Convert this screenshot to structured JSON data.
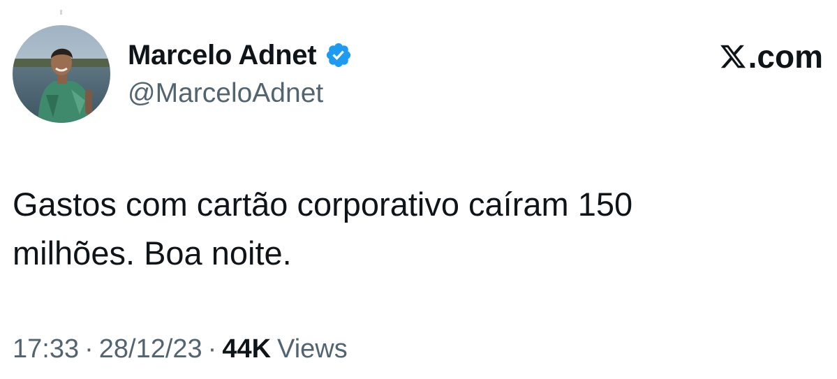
{
  "author": {
    "display_name": "Marcelo Adnet",
    "handle": "@MarceloAdnet",
    "verified": true,
    "verified_color": "#1d9bf0"
  },
  "watermark": {
    "text": ".com",
    "logo": "x-logo-icon"
  },
  "tweet": {
    "text": "Gastos com cartão corporativo caíram 150\nmilhões. Boa noite."
  },
  "meta": {
    "time": "17:33",
    "separator": "·",
    "date": "28/12/23",
    "views_count": "44K",
    "views_label": "Views"
  },
  "colors": {
    "text_primary": "#0f1419",
    "text_secondary": "#536471",
    "background": "#ffffff"
  }
}
